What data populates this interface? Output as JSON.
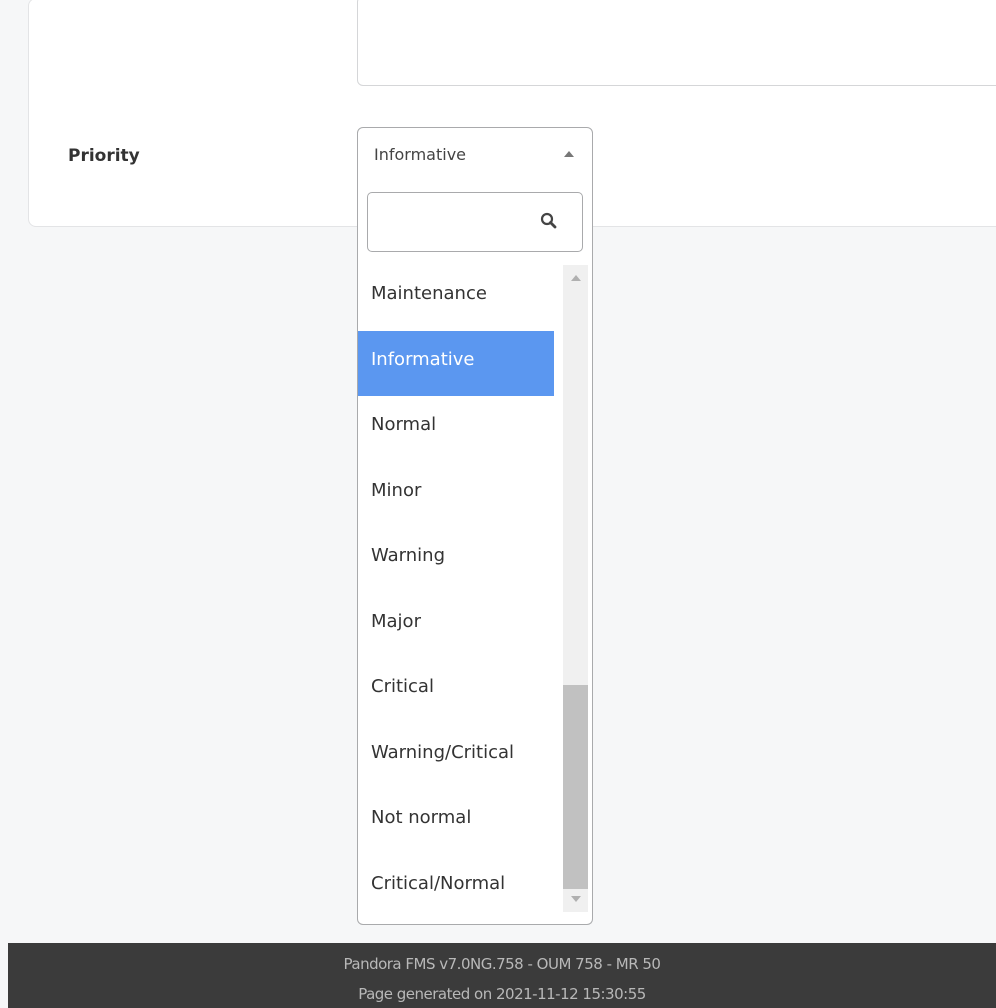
{
  "form": {
    "priority_label": "Priority",
    "priority_select": {
      "selected": "Informative",
      "search_value": "",
      "options": [
        "Maintenance",
        "Informative",
        "Normal",
        "Minor",
        "Warning",
        "Major",
        "Critical",
        "Warning/Critical",
        "Not normal",
        "Critical/Normal"
      ],
      "selected_index": 1
    }
  },
  "footer": {
    "version": "Pandora FMS v7.0NG.758 - OUM 758 - MR 50",
    "generated": "Page generated on 2021-11-12 15:30:55"
  },
  "colors": {
    "selected_option_bg": "#5b97f0",
    "footer_bg": "#3b3b3b"
  },
  "icons": {
    "search": "search-icon",
    "select_arrow": "caret-up-icon"
  }
}
